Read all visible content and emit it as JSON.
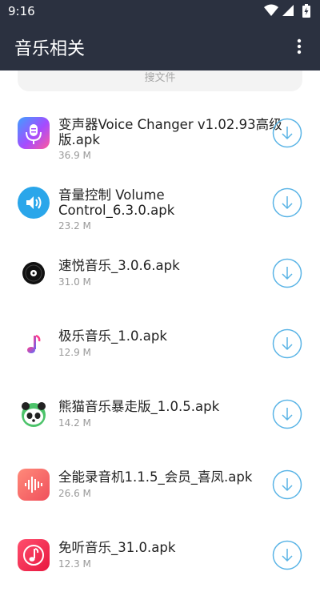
{
  "status_bar": {
    "time": "9:16",
    "icons": [
      "wifi-icon",
      "signal-icon",
      "battery-icon"
    ]
  },
  "app_bar": {
    "title": "音乐相关",
    "menu_icon": "more-vert-icon"
  },
  "search": {
    "placeholder": "搜文件"
  },
  "files": [
    {
      "name": "变声器Voice Changer v1.02.93高级版.apk",
      "size": "36.9 M",
      "icon": "microphone-icon"
    },
    {
      "name": "音量控制 Volume Control_6.3.0.apk",
      "size": "23.2 M",
      "icon": "speaker-icon"
    },
    {
      "name": "速悦音乐_3.0.6.apk",
      "size": "31.0 M",
      "icon": "vinyl-icon"
    },
    {
      "name": "极乐音乐_1.0.apk",
      "size": "12.9 M",
      "icon": "music-note-icon"
    },
    {
      "name": "熊猫音乐暴走版_1.0.5.apk",
      "size": "14.2 M",
      "icon": "panda-icon"
    },
    {
      "name": "全能录音机1.1.5_会员_喜凤.apk",
      "size": "26.6 M",
      "icon": "waveform-icon"
    },
    {
      "name": "免听音乐_31.0.apk",
      "size": "12.3 M",
      "icon": "music-note-icon"
    }
  ],
  "colors": {
    "header": "#2b3140",
    "accent": "#5ab4e6"
  }
}
